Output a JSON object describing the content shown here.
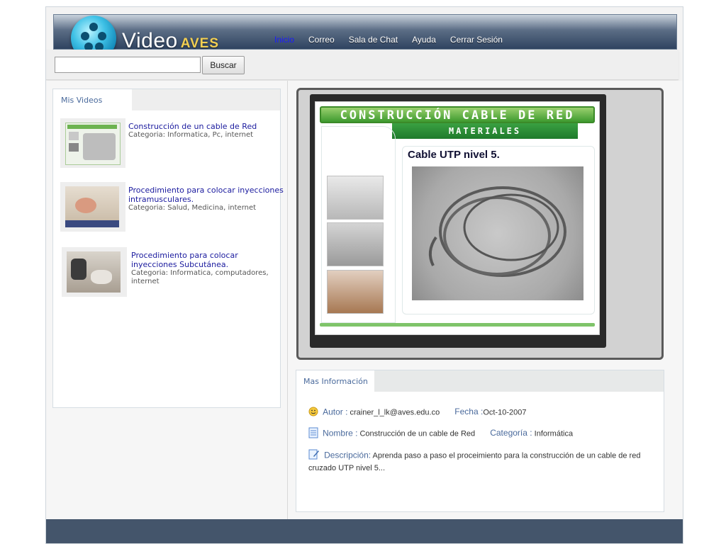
{
  "header": {
    "logo_main": "Video",
    "logo_sub": "AVES",
    "nav": [
      "Inicio",
      "Correo",
      "Sala de Chat",
      "Ayuda",
      "Cerrar Sesión"
    ]
  },
  "search": {
    "value": "",
    "placeholder": "",
    "button_label": "Buscar"
  },
  "my_videos": {
    "tab_label": "Mis Videos",
    "items": [
      {
        "title": "Construcción de un cable de Red",
        "category": "Categoria: Informatica, Pc, internet"
      },
      {
        "title": "Procedimiento para colocar inyecciones intramusculares.",
        "category": "Categoria: Salud, Medicina, internet"
      },
      {
        "title": "Procedimiento para colocar inyecciones Subcutánea.",
        "category": "Categoria: Informatica, computadores, internet"
      }
    ]
  },
  "player": {
    "slide_title": "CONSTRUCCIÓN CABLE DE RED",
    "slide_subtitle": "MATERIALES",
    "slide_caption": "Cable UTP nivel 5.",
    "side_icons": [
      "heart-icon",
      "star-icon",
      "balloons-icon",
      "save-icon",
      "report-icon"
    ]
  },
  "more_info": {
    "tab_label": "Mas Información",
    "author_label": "Autor :",
    "author_value": "crainer_l_lk@aves.edu.co",
    "date_label": "Fecha :",
    "date_value": "Oct-10-2007",
    "name_label": "Nombre :",
    "name_value": "Construcción de un cable de Red",
    "category_label": "Categoría :",
    "category_value": "Informática",
    "description_label": "Descripción:",
    "description_value": "Aprenda paso a paso el proceimiento para la construcción de un cable de red cruzado UTP nivel 5..."
  },
  "colors": {
    "header_dark": "#2f4360",
    "accent_link": "#1a1a9e",
    "active_nav": "#1a1aff",
    "footer": "#44556b",
    "logo_sub": "#f2cf52"
  }
}
